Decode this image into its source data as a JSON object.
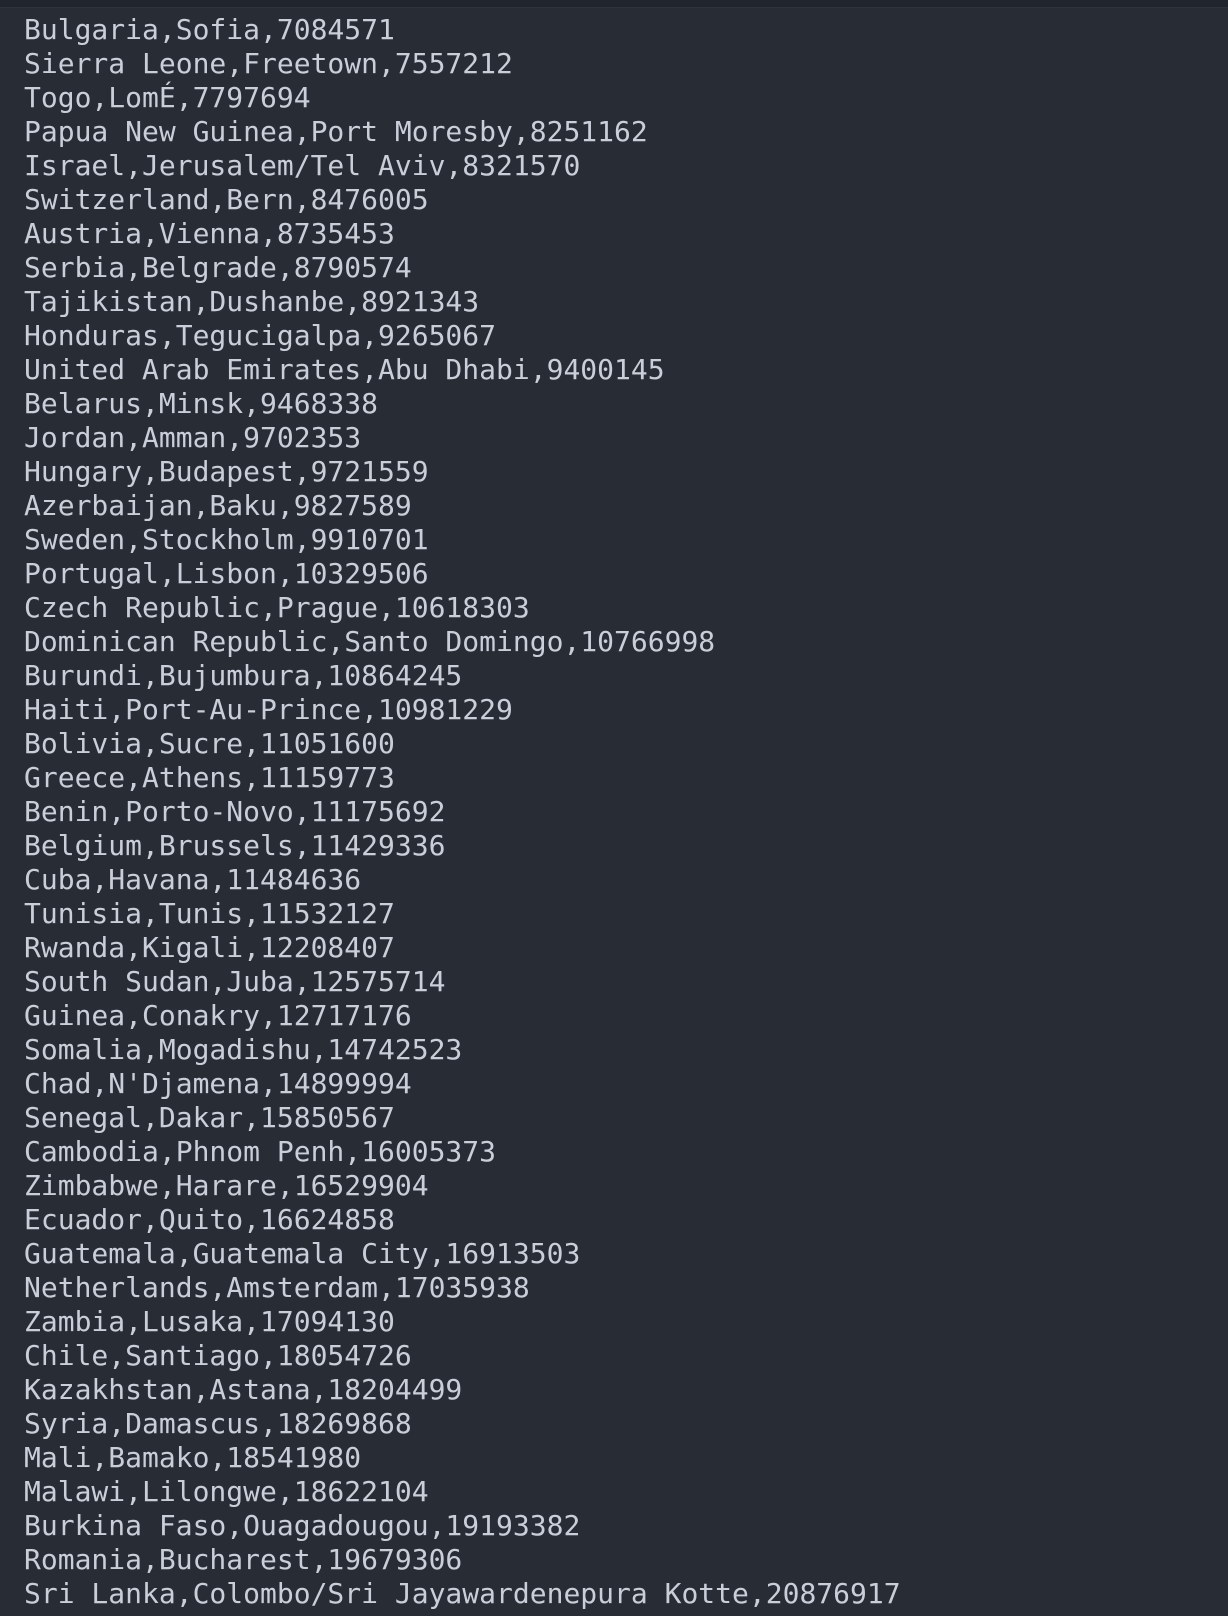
{
  "editor": {
    "lines": [
      "Bulgaria,Sofia,7084571",
      "Sierra Leone,Freetown,7557212",
      "Togo,LomÉ,7797694",
      "Papua New Guinea,Port Moresby,8251162",
      "Israel,Jerusalem/Tel Aviv,8321570",
      "Switzerland,Bern,8476005",
      "Austria,Vienna,8735453",
      "Serbia,Belgrade,8790574",
      "Tajikistan,Dushanbe,8921343",
      "Honduras,Tegucigalpa,9265067",
      "United Arab Emirates,Abu Dhabi,9400145",
      "Belarus,Minsk,9468338",
      "Jordan,Amman,9702353",
      "Hungary,Budapest,9721559",
      "Azerbaijan,Baku,9827589",
      "Sweden,Stockholm,9910701",
      "Portugal,Lisbon,10329506",
      "Czech Republic,Prague,10618303",
      "Dominican Republic,Santo Domingo,10766998",
      "Burundi,Bujumbura,10864245",
      "Haiti,Port-Au-Prince,10981229",
      "Bolivia,Sucre,11051600",
      "Greece,Athens,11159773",
      "Benin,Porto-Novo,11175692",
      "Belgium,Brussels,11429336",
      "Cuba,Havana,11484636",
      "Tunisia,Tunis,11532127",
      "Rwanda,Kigali,12208407",
      "South Sudan,Juba,12575714",
      "Guinea,Conakry,12717176",
      "Somalia,Mogadishu,14742523",
      "Chad,N'Djamena,14899994",
      "Senegal,Dakar,15850567",
      "Cambodia,Phnom Penh,16005373",
      "Zimbabwe,Harare,16529904",
      "Ecuador,Quito,16624858",
      "Guatemala,Guatemala City,16913503",
      "Netherlands,Amsterdam,17035938",
      "Zambia,Lusaka,17094130",
      "Chile,Santiago,18054726",
      "Kazakhstan,Astana,18204499",
      "Syria,Damascus,18269868",
      "Mali,Bamako,18541980",
      "Malawi,Lilongwe,18622104",
      "Burkina Faso,Ouagadougou,19193382",
      "Romania,Bucharest,19679306",
      "Sri Lanka,Colombo/Sri Jayawardenepura Kotte,20876917"
    ]
  }
}
